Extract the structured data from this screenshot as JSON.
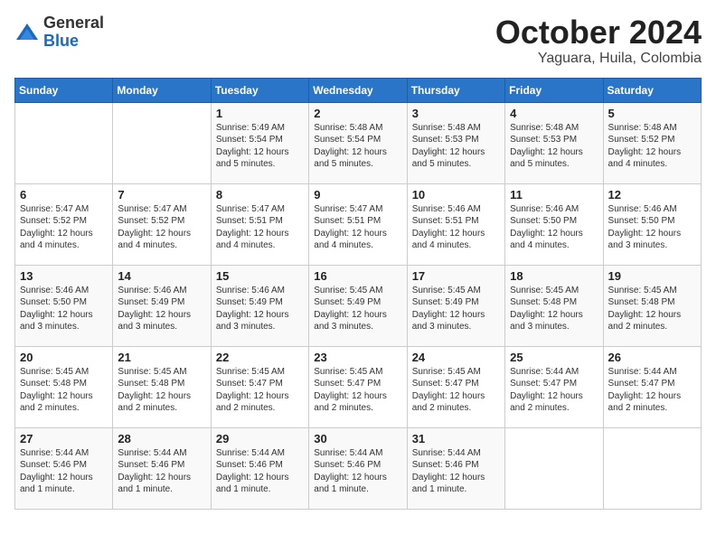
{
  "logo": {
    "general": "General",
    "blue": "Blue"
  },
  "title": {
    "month": "October 2024",
    "location": "Yaguara, Huila, Colombia"
  },
  "days_of_week": [
    "Sunday",
    "Monday",
    "Tuesday",
    "Wednesday",
    "Thursday",
    "Friday",
    "Saturday"
  ],
  "weeks": [
    [
      {
        "day": "",
        "info": ""
      },
      {
        "day": "",
        "info": ""
      },
      {
        "day": "1",
        "info": "Sunrise: 5:49 AM\nSunset: 5:54 PM\nDaylight: 12 hours\nand 5 minutes."
      },
      {
        "day": "2",
        "info": "Sunrise: 5:48 AM\nSunset: 5:54 PM\nDaylight: 12 hours\nand 5 minutes."
      },
      {
        "day": "3",
        "info": "Sunrise: 5:48 AM\nSunset: 5:53 PM\nDaylight: 12 hours\nand 5 minutes."
      },
      {
        "day": "4",
        "info": "Sunrise: 5:48 AM\nSunset: 5:53 PM\nDaylight: 12 hours\nand 5 minutes."
      },
      {
        "day": "5",
        "info": "Sunrise: 5:48 AM\nSunset: 5:52 PM\nDaylight: 12 hours\nand 4 minutes."
      }
    ],
    [
      {
        "day": "6",
        "info": "Sunrise: 5:47 AM\nSunset: 5:52 PM\nDaylight: 12 hours\nand 4 minutes."
      },
      {
        "day": "7",
        "info": "Sunrise: 5:47 AM\nSunset: 5:52 PM\nDaylight: 12 hours\nand 4 minutes."
      },
      {
        "day": "8",
        "info": "Sunrise: 5:47 AM\nSunset: 5:51 PM\nDaylight: 12 hours\nand 4 minutes."
      },
      {
        "day": "9",
        "info": "Sunrise: 5:47 AM\nSunset: 5:51 PM\nDaylight: 12 hours\nand 4 minutes."
      },
      {
        "day": "10",
        "info": "Sunrise: 5:46 AM\nSunset: 5:51 PM\nDaylight: 12 hours\nand 4 minutes."
      },
      {
        "day": "11",
        "info": "Sunrise: 5:46 AM\nSunset: 5:50 PM\nDaylight: 12 hours\nand 4 minutes."
      },
      {
        "day": "12",
        "info": "Sunrise: 5:46 AM\nSunset: 5:50 PM\nDaylight: 12 hours\nand 3 minutes."
      }
    ],
    [
      {
        "day": "13",
        "info": "Sunrise: 5:46 AM\nSunset: 5:50 PM\nDaylight: 12 hours\nand 3 minutes."
      },
      {
        "day": "14",
        "info": "Sunrise: 5:46 AM\nSunset: 5:49 PM\nDaylight: 12 hours\nand 3 minutes."
      },
      {
        "day": "15",
        "info": "Sunrise: 5:46 AM\nSunset: 5:49 PM\nDaylight: 12 hours\nand 3 minutes."
      },
      {
        "day": "16",
        "info": "Sunrise: 5:45 AM\nSunset: 5:49 PM\nDaylight: 12 hours\nand 3 minutes."
      },
      {
        "day": "17",
        "info": "Sunrise: 5:45 AM\nSunset: 5:49 PM\nDaylight: 12 hours\nand 3 minutes."
      },
      {
        "day": "18",
        "info": "Sunrise: 5:45 AM\nSunset: 5:48 PM\nDaylight: 12 hours\nand 3 minutes."
      },
      {
        "day": "19",
        "info": "Sunrise: 5:45 AM\nSunset: 5:48 PM\nDaylight: 12 hours\nand 2 minutes."
      }
    ],
    [
      {
        "day": "20",
        "info": "Sunrise: 5:45 AM\nSunset: 5:48 PM\nDaylight: 12 hours\nand 2 minutes."
      },
      {
        "day": "21",
        "info": "Sunrise: 5:45 AM\nSunset: 5:48 PM\nDaylight: 12 hours\nand 2 minutes."
      },
      {
        "day": "22",
        "info": "Sunrise: 5:45 AM\nSunset: 5:47 PM\nDaylight: 12 hours\nand 2 minutes."
      },
      {
        "day": "23",
        "info": "Sunrise: 5:45 AM\nSunset: 5:47 PM\nDaylight: 12 hours\nand 2 minutes."
      },
      {
        "day": "24",
        "info": "Sunrise: 5:45 AM\nSunset: 5:47 PM\nDaylight: 12 hours\nand 2 minutes."
      },
      {
        "day": "25",
        "info": "Sunrise: 5:44 AM\nSunset: 5:47 PM\nDaylight: 12 hours\nand 2 minutes."
      },
      {
        "day": "26",
        "info": "Sunrise: 5:44 AM\nSunset: 5:47 PM\nDaylight: 12 hours\nand 2 minutes."
      }
    ],
    [
      {
        "day": "27",
        "info": "Sunrise: 5:44 AM\nSunset: 5:46 PM\nDaylight: 12 hours\nand 1 minute."
      },
      {
        "day": "28",
        "info": "Sunrise: 5:44 AM\nSunset: 5:46 PM\nDaylight: 12 hours\nand 1 minute."
      },
      {
        "day": "29",
        "info": "Sunrise: 5:44 AM\nSunset: 5:46 PM\nDaylight: 12 hours\nand 1 minute."
      },
      {
        "day": "30",
        "info": "Sunrise: 5:44 AM\nSunset: 5:46 PM\nDaylight: 12 hours\nand 1 minute."
      },
      {
        "day": "31",
        "info": "Sunrise: 5:44 AM\nSunset: 5:46 PM\nDaylight: 12 hours\nand 1 minute."
      },
      {
        "day": "",
        "info": ""
      },
      {
        "day": "",
        "info": ""
      }
    ]
  ]
}
